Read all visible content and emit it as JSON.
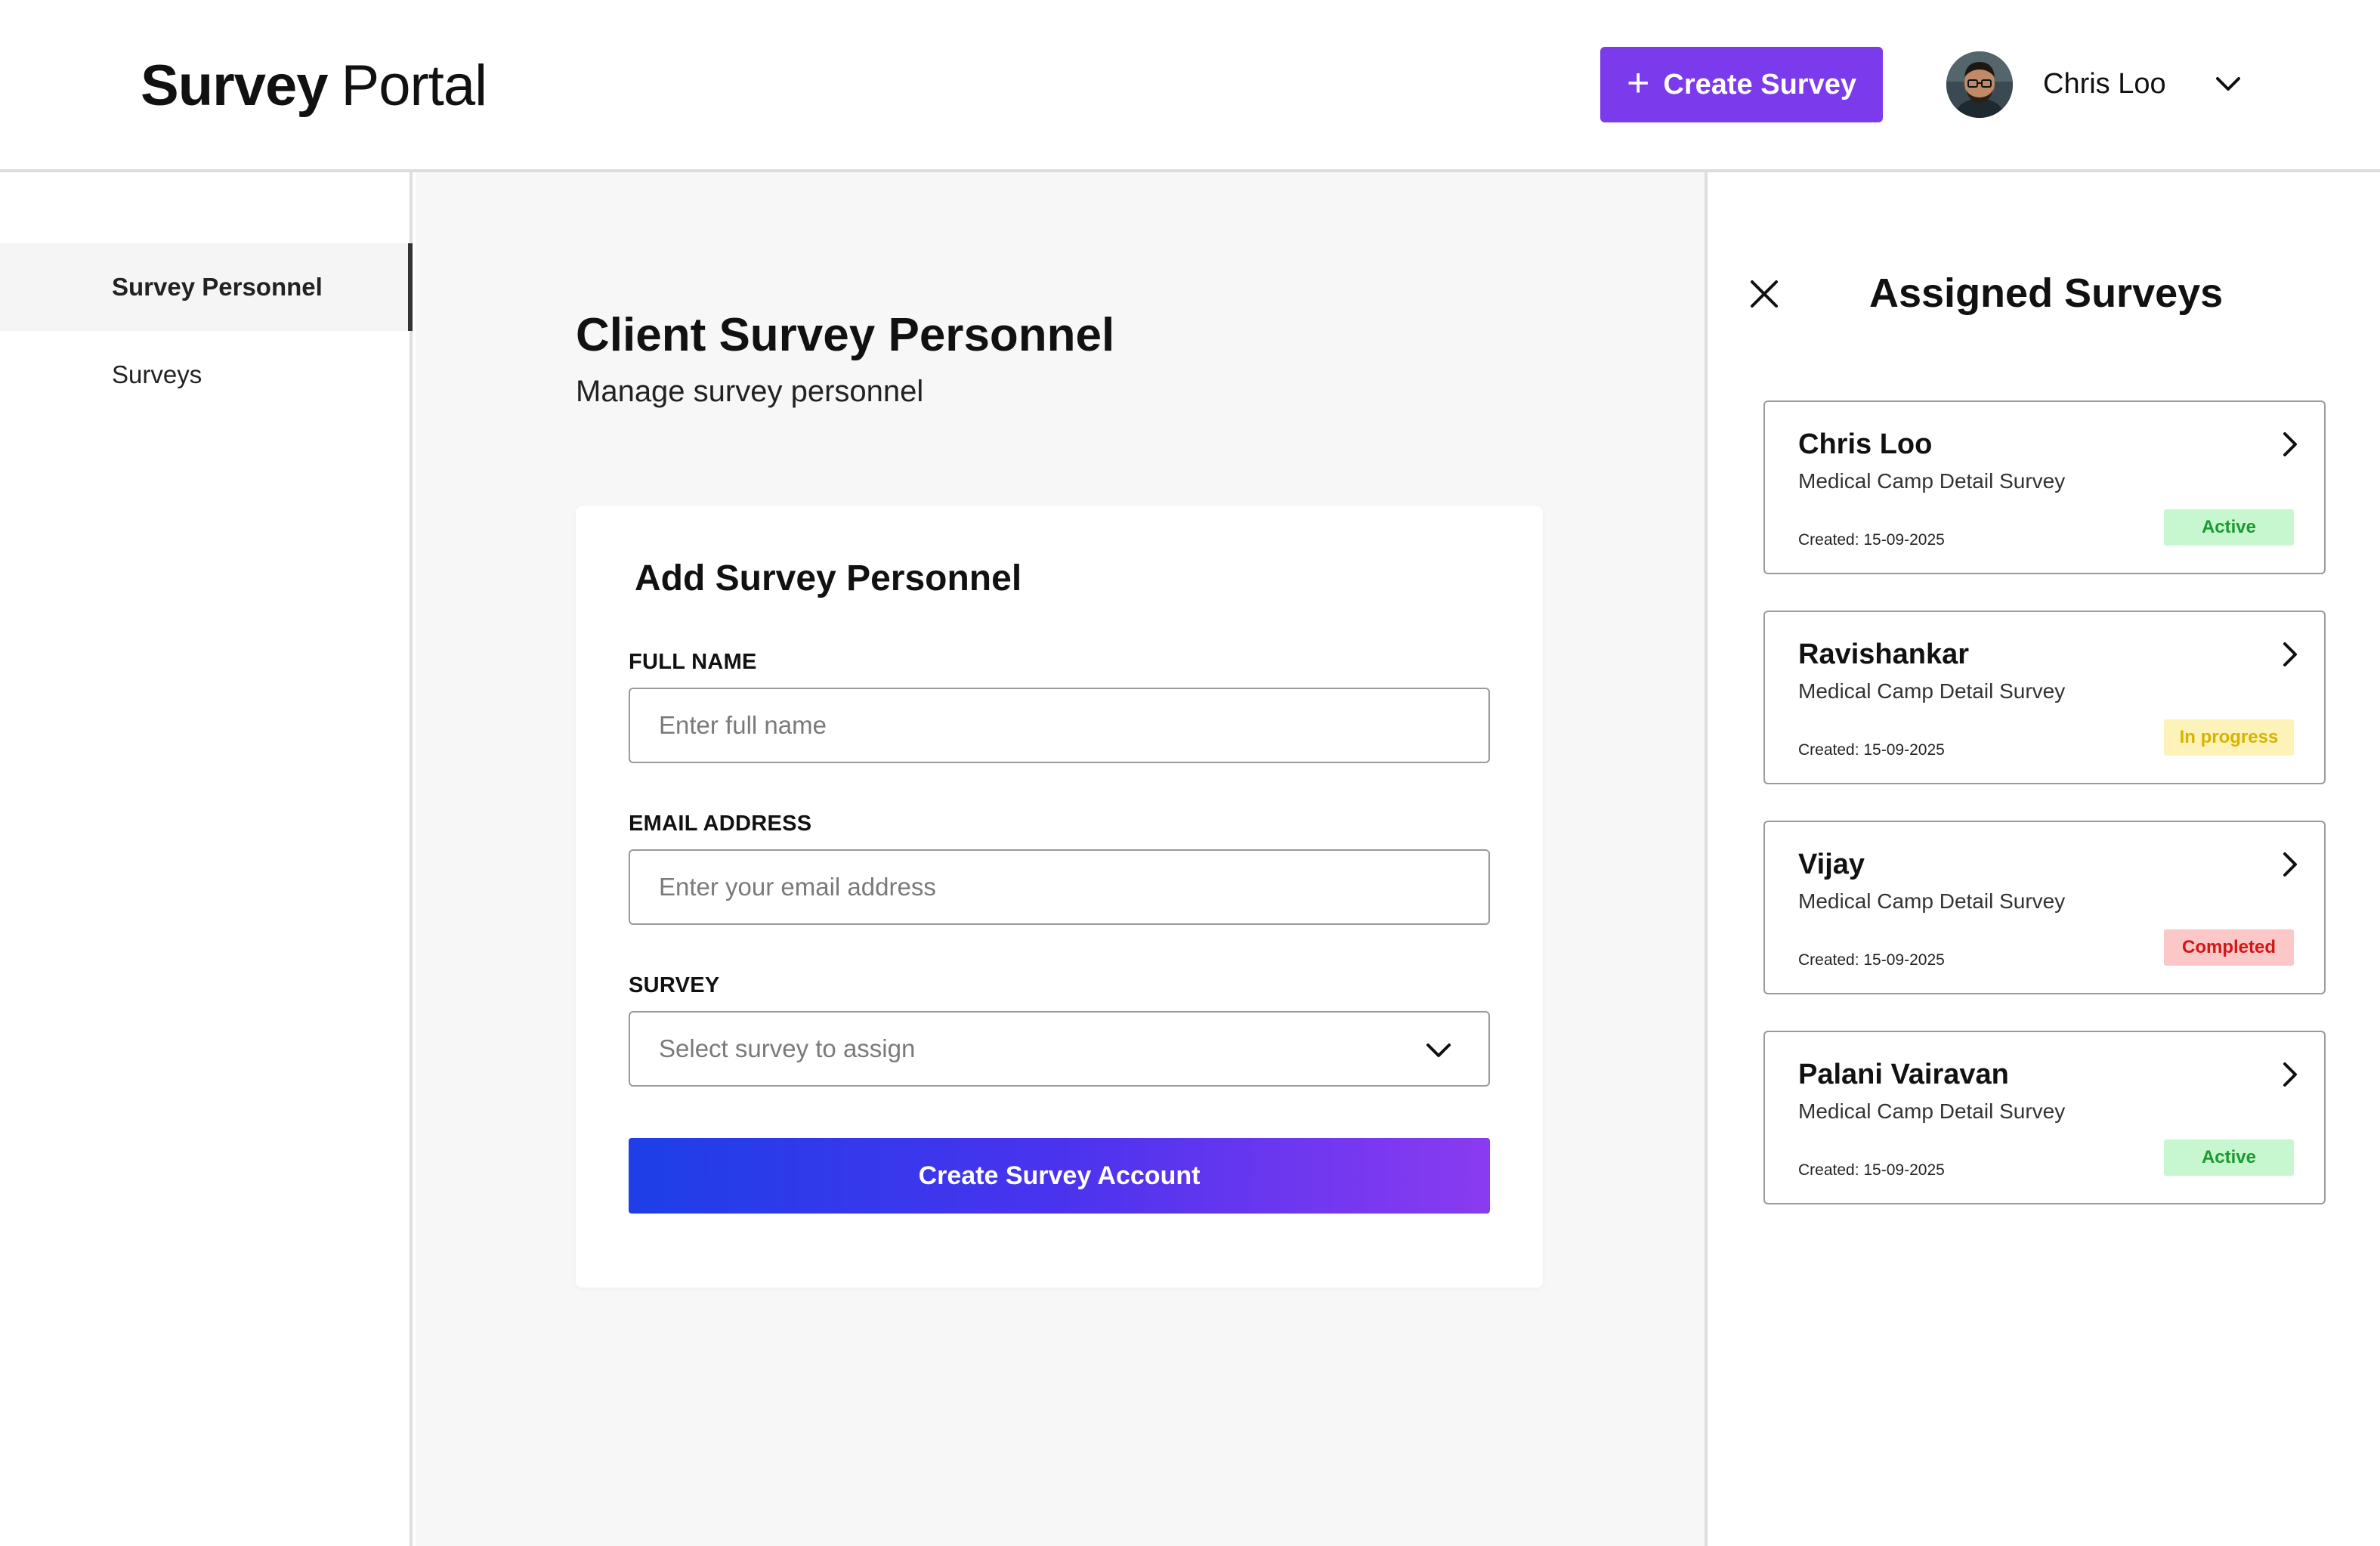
{
  "header": {
    "brand_strong": "Survey",
    "brand_light": "Portal",
    "create_label": "Create Survey",
    "user_name": "Chris Loo"
  },
  "sidebar": {
    "items": [
      {
        "label": "Survey Personnel",
        "active": true
      },
      {
        "label": "Surveys",
        "active": false
      }
    ]
  },
  "main": {
    "title": "Client Survey Personnel",
    "subtitle": "Manage survey personnel",
    "form": {
      "title": "Add Survey Personnel",
      "full_name": {
        "label": "FULL NAME",
        "placeholder": "Enter full name"
      },
      "email": {
        "label": "EMAIL ADDRESS",
        "placeholder": "Enter your email address"
      },
      "survey": {
        "label": "SURVEY",
        "placeholder": "Select survey to assign"
      },
      "submit_label": "Create Survey Account"
    }
  },
  "panel": {
    "title": "Assigned Surveys",
    "cards": [
      {
        "name": "Chris Loo",
        "survey": "Medical Camp Detail Survey",
        "created": "Created: 15-09-2025",
        "status": "Active",
        "status_color": "#1b9a2e"
      },
      {
        "name": "Ravishankar",
        "survey": "Medical Camp Detail Survey",
        "created": "Created: 15-09-2025",
        "status": "In progress",
        "status_color": "#d9b200"
      },
      {
        "name": "Vijay",
        "survey": "Medical Camp Detail Survey",
        "created": "Created: 15-09-2025",
        "status": "Completed",
        "status_color": "#d31616"
      },
      {
        "name": "Palani Vairavan",
        "survey": "Medical Camp Detail Survey",
        "created": "Created: 15-09-2025",
        "status": "Active",
        "status_color": "#1b9a2e"
      }
    ]
  },
  "colors": {
    "accent": "#7c3aed",
    "gradient_start": "#1d3fe8",
    "gradient_end": "#8a3bf0"
  },
  "icons": [
    "plus-icon",
    "user-avatar",
    "chevron-down-icon",
    "close-icon",
    "chevron-right-icon"
  ]
}
